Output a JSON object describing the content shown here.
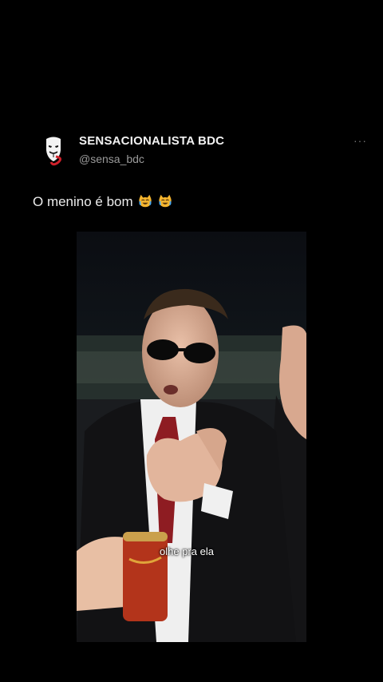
{
  "post": {
    "account_name": "SENSACIONALISTA BDC",
    "handle": "@sensa_bdc",
    "more_label": "···",
    "caption_text": "O menino é bom",
    "caption_emojis": [
      "joy-cat-emoji",
      "joy-cat-emoji"
    ]
  },
  "video": {
    "subtitle": "olhe pra ela"
  },
  "colors": {
    "background": "#000000",
    "name_text": "#f2f2f2",
    "handle_text": "#9a9a9a"
  }
}
